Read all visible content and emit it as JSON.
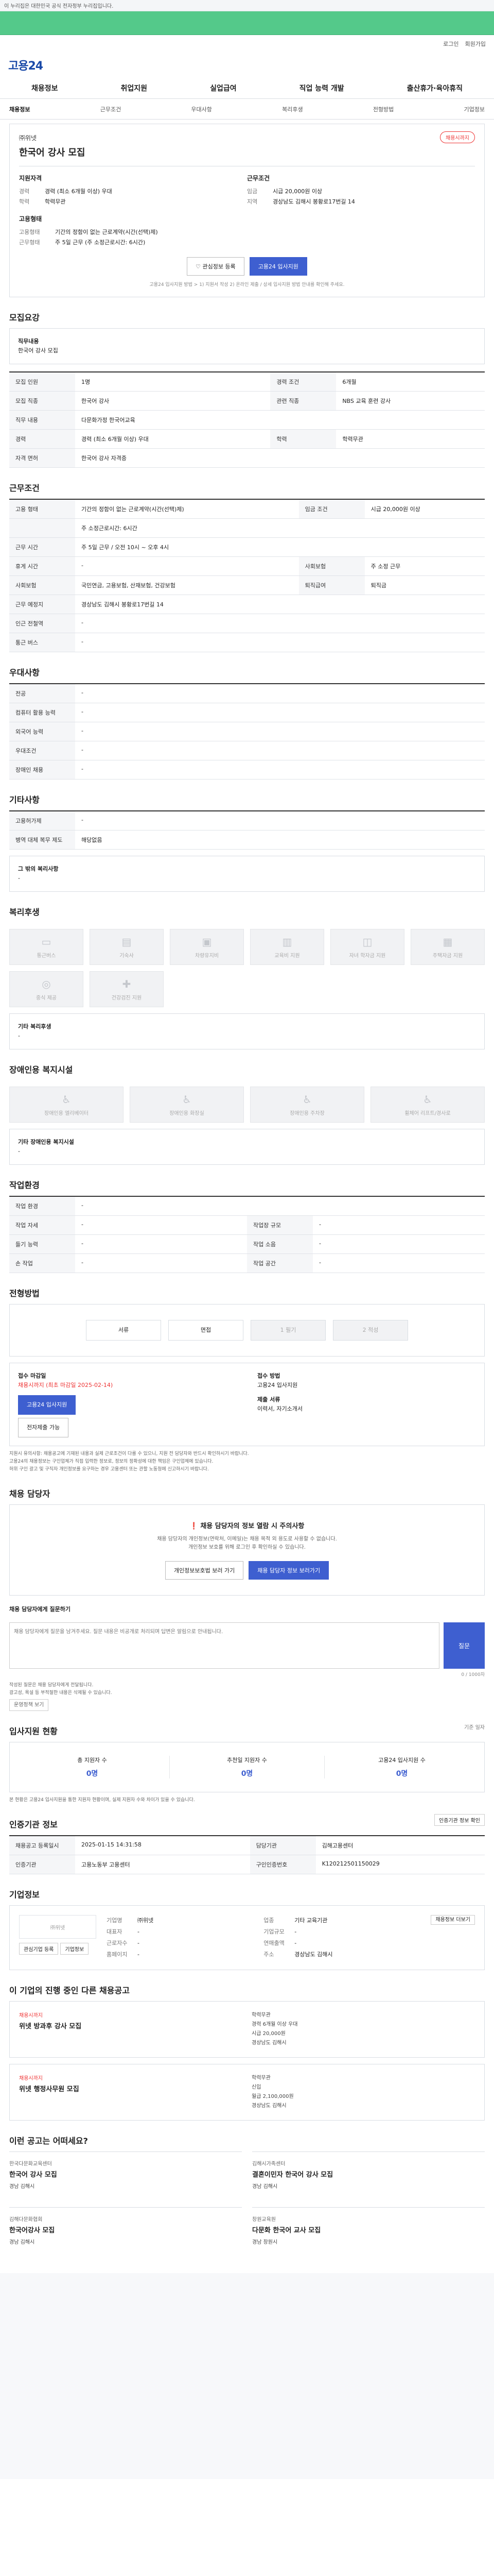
{
  "topbar": {
    "notice": "이 누리집은 대한민국 공식 전자정부 누리집입니다."
  },
  "util": {
    "login": "로그인",
    "join": "회원가입"
  },
  "logo": "고용24",
  "gnb": [
    "채용정보",
    "취업지원",
    "실업급여",
    "직업 능력 개발",
    "출산휴가·육아휴직"
  ],
  "tabs": [
    "채용정보",
    "근무조건",
    "우대사항",
    "복리후생",
    "전형방법",
    "기업정보"
  ],
  "summary": {
    "corp": "㈜위넷",
    "title": "한국어 강사 모집",
    "badge": "채용시까지",
    "left_head": "지원자격",
    "left_rows": [
      {
        "k": "경력",
        "v": "경력 (최소 6개월 이상) 우대"
      },
      {
        "k": "학력",
        "v": "학력무관"
      }
    ],
    "right_head": "근무조건",
    "right_rows": [
      {
        "k": "임금",
        "v": "시급 20,000원 이상"
      },
      {
        "k": "지역",
        "v": "경상남도 김해시 봉황로17번길 14"
      }
    ],
    "sub_head": "고용형태",
    "sub_rows": [
      {
        "k": "고용형태",
        "v": "기간의 정함이 없는 근로계약(시간(선택)제)"
      },
      {
        "k": "근무형태",
        "v": "주 5일 근무 (주 소정근로시간: 6시간)"
      }
    ],
    "btn_save": "관심정보 등록",
    "btn_apply": "고용24 입사지원",
    "note": "고용24 입사지원 방법 > 1) 지원서 작성 2) 온라인 제출 / 상세 입사지원 방법 안내를 확인해 주세요."
  },
  "sections": {
    "recruit": "모집요강",
    "conditions": "근무조건",
    "prefer": "우대사항",
    "other": "기타사항",
    "welfare": "복리후생",
    "disabled": "장애인용 복지시설",
    "workenv": "작업환경",
    "process": "전형방법",
    "contact": "채용 담당자",
    "apply_status": "입사지원 현황",
    "registrar": "인증기관 정보",
    "company": "기업정보",
    "similar": "이 기업의 진행 중인 다른 채용공고",
    "recommend": "이런 공고는 어떠세요?"
  },
  "recruit_box": {
    "label": "직무내용",
    "value": "한국어 강사 모집"
  },
  "recruit_table": [
    {
      "k": "모집 인원",
      "v": "1명",
      "k2": "경력 조건",
      "v2": "6개월"
    },
    {
      "k": "모집 직종",
      "v": "한국어 강사",
      "k2": "관련 직종",
      "v2": "NBS 교육 훈련 강사"
    },
    {
      "k": "직무 내용",
      "v": "다문화가정 한국어교육",
      "k2": "",
      "v2": ""
    },
    {
      "k": "경력",
      "v": "경력 (최소 6개월 이상) 우대",
      "k2": "학력",
      "v2": "학력무관"
    },
    {
      "k": "자격 면허",
      "v": "한국어 강사 자격증",
      "k2": "",
      "v2": ""
    }
  ],
  "cond_table": [
    {
      "k": "고용 형태",
      "v": "기간의 정함이 없는 근로계약(시간(선택)제)",
      "k2": "임금 조건",
      "v2": "시급 20,000원 이상"
    },
    {
      "k": "",
      "v": "주 소정근로시간: 6시간",
      "k2": "",
      "v2": ""
    },
    {
      "k": "근무 시간",
      "v": "주 5일 근무 / 오전 10시 ~ 오후 4시",
      "k2": "",
      "v2": ""
    },
    {
      "k": "휴게 시간",
      "v": "-",
      "k2": "사회보험",
      "v2": "주 소정 근무"
    },
    {
      "k": "사회보험",
      "v": "국민연금, 고용보험, 산재보험, 건강보험",
      "k2": "퇴직급여",
      "v2": "퇴직금"
    },
    {
      "k": "근무 예정지",
      "v": "경상남도 김해시 봉황로17번길 14",
      "k2": "",
      "v2": ""
    },
    {
      "k": "인근 전철역",
      "v": "-",
      "k2": "",
      "v2": ""
    },
    {
      "k": "통근 버스",
      "v": "-",
      "k2": "",
      "v2": ""
    }
  ],
  "prefer_table": [
    {
      "k": "전공",
      "v": "-"
    },
    {
      "k": "컴퓨터 활용 능력",
      "v": "-"
    },
    {
      "k": "외국어 능력",
      "v": "-"
    },
    {
      "k": "우대조건",
      "v": "-"
    },
    {
      "k": "장애인 채용",
      "v": "-"
    }
  ],
  "other_table": [
    {
      "k": "고용허가제",
      "v": "-"
    },
    {
      "k": "병역 대체 복무 제도",
      "v": "해당없음"
    }
  ],
  "other_box": {
    "label": "그 밖의 복리사항",
    "value": "-"
  },
  "welfare_icons": [
    "통근버스",
    "기숙사",
    "차량유지비",
    "교육비 지원",
    "자녀 학자금 지원",
    "주택자금 지원",
    "중식 제공",
    "건강검진 지원"
  ],
  "welfare_box": {
    "label": "기타 복리후생",
    "value": "-"
  },
  "disabled_icons": [
    "장애인용 엘리베이터",
    "장애인용 화장실",
    "장애인용 주차장",
    "휠체어 리프트/경사로"
  ],
  "disabled_box": {
    "label": "기타 장애인용 복지시설",
    "value": "-"
  },
  "workenv_table": [
    {
      "k": "작업 환경",
      "v": "-",
      "k2": "",
      "v2": ""
    },
    {
      "k": "작업 자세",
      "v": "-",
      "k2": "작업장 규모",
      "v2": "-"
    },
    {
      "k": "들기 능력",
      "v": "-",
      "k2": "작업 소음",
      "v2": "-"
    },
    {
      "k": "손 작업",
      "v": "-",
      "k2": "작업 공간",
      "v2": "-"
    }
  ],
  "process_steps": [
    "서류",
    "면접",
    "1 필기",
    "2 적성"
  ],
  "apply_info": {
    "head": "접수 마감일",
    "deadline": "채용시까지 (최초 마감일 2025-02-14)",
    "method_head": "접수 방법",
    "methods": "고용24 입사지원",
    "doc_head": "제출 서류",
    "docs": "이력서, 자기소개서",
    "btn_apply": "고용24 입사지원",
    "btn_docs": "전자제출 가능"
  },
  "warn_lines": [
    "지원시 유의사항: 채용공고에 기재된 내용과 실제 근로조건이 다를 수 있으니, 지원 전 담당자와 반드시 확인하시기 바랍니다.",
    "고용24의 채용정보는 구인업체가 직접 입력한 정보로, 정보의 정확성에 대한 책임은 구인업체에 있습니다.",
    "허위 구인 광고 및 구직자 개인정보를 요구하는 경우 고용센터 또는 관할 노동청에 신고하시기 바랍니다."
  ],
  "contact": {
    "alert": "채용 담당자의 정보 열람 시 주의사항",
    "line1": "채용 담당자의 개인정보(연락처, 이메일)는 채용 목적 외 용도로 사용할 수 없습니다.",
    "line2": "개인정보 보호를 위해 로그인 후 확인하실 수 있습니다.",
    "btn1": "개인정보보호법 보러 가기",
    "btn2": "채용 담당자 정보 보러가기"
  },
  "question": {
    "head": "채용 담당자에게 질문하기",
    "placeholder": "채용 담당자에게 질문을 남겨주세요. 질문 내용은 비공개로 처리되며 답변은 알림으로 안내됩니다.",
    "counter": "0 / 1000자",
    "btn": "질문",
    "notes": [
      "작성된 질문은 채용 담당자에게 전달됩니다.",
      "광고성, 욕설 등 부적절한 내용은 삭제될 수 있습니다."
    ],
    "policy_btn": "운영정책 보기"
  },
  "stats": {
    "head_note": "기준 일자",
    "items": [
      {
        "label": "총 지원자 수",
        "value": "0명"
      },
      {
        "label": "추천일 지원자 수",
        "value": "0명"
      },
      {
        "label": "고용24 입사지원 수",
        "value": "0명"
      }
    ],
    "note": "본 현황은 고용24 입사지원을 통한 지원자 현황이며, 실제 지원자 수와 차이가 있을 수 있습니다."
  },
  "registrar": {
    "btn": "인증기관 정보 확인",
    "rows": [
      {
        "k": "채용공고 등록일시",
        "v": "2025-01-15 14:31:58",
        "k2": "담당기관",
        "v2": "김해고용센터"
      },
      {
        "k": "인증기관",
        "v": "고용노동부 고용센터",
        "k2": "구인인증번호",
        "v2": "K120212501150029"
      }
    ],
    "btn2": "지도 보기"
  },
  "company": {
    "logo": "㈜위넷",
    "rows": [
      {
        "k": "기업명",
        "v": "㈜위넷",
        "k2": "업종",
        "v2": "기타 교육기관"
      },
      {
        "k": "대표자",
        "v": "-",
        "k2": "기업규모",
        "v2": "-"
      },
      {
        "k": "근로자수",
        "v": "-",
        "k2": "연매출액",
        "v2": "-"
      },
      {
        "k": "홈페이지",
        "v": "-",
        "k2": "주소",
        "v2": "경상남도 김해시"
      }
    ],
    "btn1": "관심기업 등록",
    "btn2": "기업정보",
    "btn3": "채용정보 더보기"
  },
  "similar": [
    {
      "flag": "채용시까지",
      "name": "위넷 방과후 강사 모집",
      "cond": [
        "학력무관",
        "경력 6개월 이상 우대",
        "시급 20,000원",
        "경상남도 김해시"
      ]
    },
    {
      "flag": "채용시까지",
      "name": "위넷 행정사무원 모집",
      "cond": [
        "학력무관",
        "신입",
        "월급 2,100,000원",
        "경상남도 김해시"
      ]
    }
  ],
  "recommend": [
    {
      "company": "한국다문화교육센터",
      "title": "한국어 강사 모집",
      "area": "경남 김해시"
    },
    {
      "company": "김해시가족센터",
      "title": "결혼이민자 한국어 강사 모집",
      "area": "경남 김해시"
    },
    {
      "company": "김해다문화협회",
      "title": "한국어강사 모집",
      "area": "경남 김해시"
    },
    {
      "company": "창원교육원",
      "title": "다문화 한국어 교사 모집",
      "area": "경남 창원시"
    }
  ]
}
